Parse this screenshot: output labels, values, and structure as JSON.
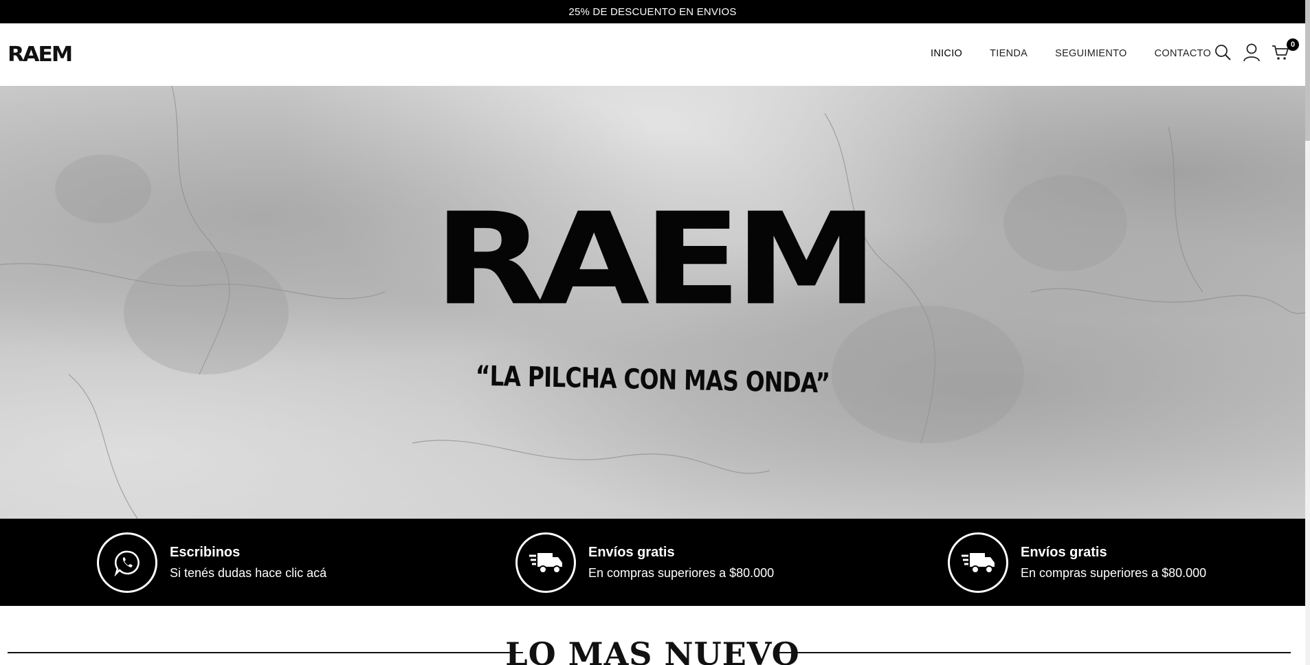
{
  "announcement": "25% DE DESCUENTO EN ENVIOS",
  "header": {
    "logo": "RAEM",
    "nav": [
      {
        "label": "INICIO",
        "active": true
      },
      {
        "label": "TIENDA",
        "active": false
      },
      {
        "label": "SEGUIMIENTO",
        "active": false
      },
      {
        "label": "CONTACTO",
        "active": false
      }
    ],
    "icons": [
      "search-icon",
      "user-icon",
      "cart-icon"
    ],
    "cart_count": "0"
  },
  "hero": {
    "title": "RAEM",
    "tagline": "“LA PILCHA CON MAS ONDA”"
  },
  "features": [
    {
      "icon": "whatsapp-icon",
      "title": "Escribinos",
      "subtitle": "Si tenés dudas hace clic acá"
    },
    {
      "icon": "delivery-truck-icon",
      "title": "Envíos gratis",
      "subtitle": "En compras superiores a $80.000"
    },
    {
      "icon": "delivery-truck-icon",
      "title": "Envíos gratis",
      "subtitle": "En compras superiores a $80.000"
    }
  ],
  "section": {
    "title": "LO MAS NUEVO"
  },
  "colors": {
    "primary": "#000000",
    "background": "#ffffff",
    "hero": "#c4c4c4"
  }
}
